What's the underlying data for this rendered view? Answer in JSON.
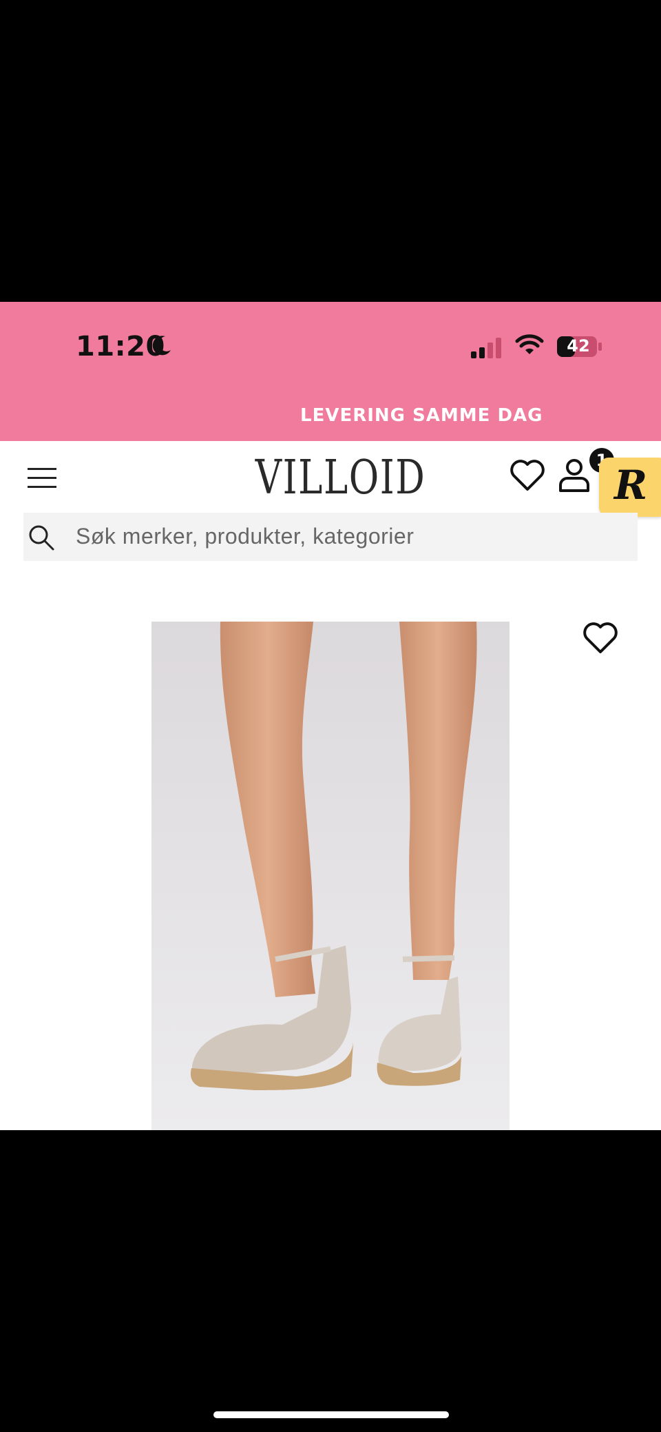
{
  "status_bar": {
    "time": "11:20",
    "battery_level": "42"
  },
  "promo_banner": {
    "text": "LEVERING SAMME DAG"
  },
  "header": {
    "logo": "VILLOID",
    "cart_count": "1",
    "floating_badge_letter": "R"
  },
  "search": {
    "placeholder": "Søk merker, produkter, kategorier"
  },
  "product": {
    "image_alt": "espadrille wedge sandals"
  },
  "colors": {
    "brand_pink": "#f07b9c",
    "badge_yellow": "#fbd46b"
  }
}
